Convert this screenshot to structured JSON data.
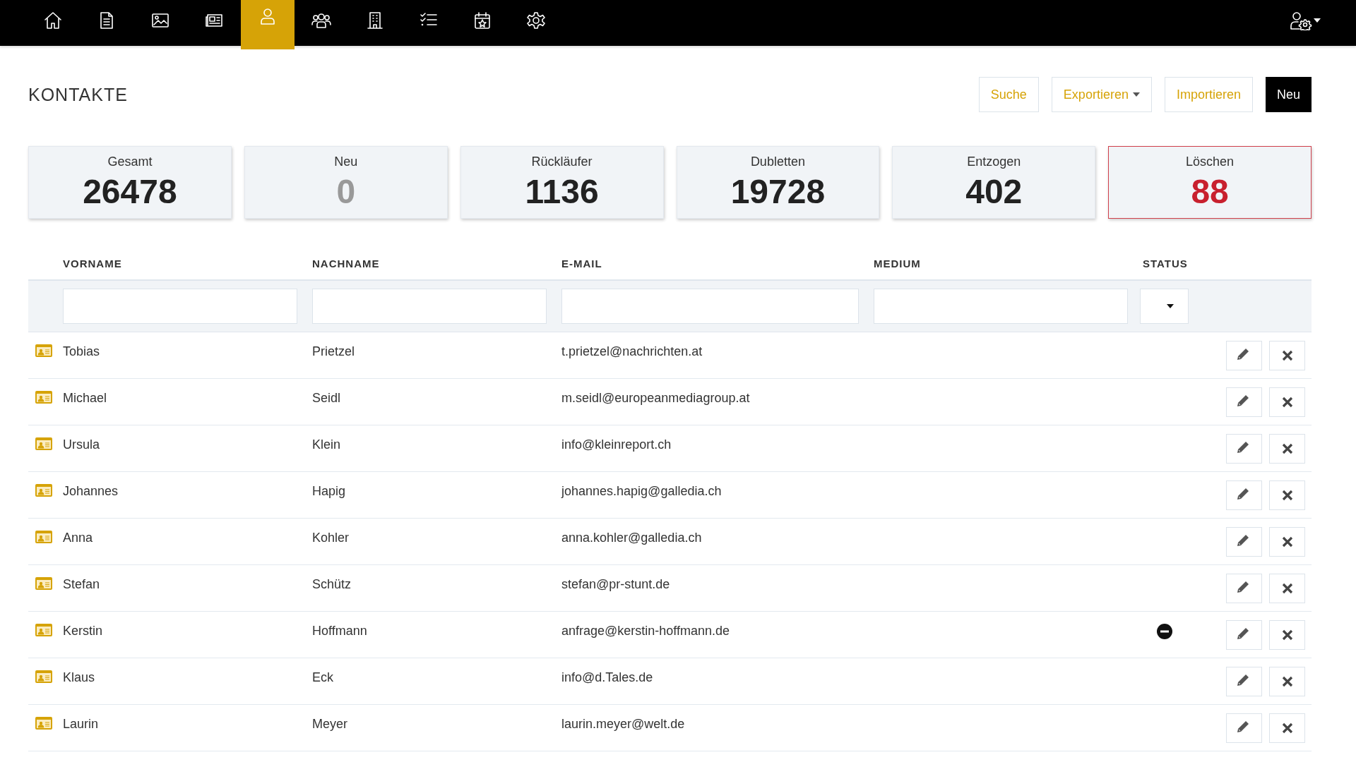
{
  "nav": {
    "items": [
      {
        "selected": false
      },
      {
        "selected": false
      },
      {
        "selected": false
      },
      {
        "selected": false
      },
      {
        "selected": true
      },
      {
        "selected": false
      },
      {
        "selected": false
      },
      {
        "selected": false
      },
      {
        "selected": false
      },
      {
        "selected": false
      }
    ]
  },
  "page": {
    "title": "KONTAKTE",
    "buttons": [
      {
        "label": "Suche",
        "kind": "outline"
      },
      {
        "label": "Exportieren",
        "kind": "dropdown"
      },
      {
        "label": "Importieren",
        "kind": "outline"
      },
      {
        "label": "Neu",
        "kind": "primary"
      }
    ]
  },
  "stats": [
    {
      "label": "Gesamt",
      "value": "26478",
      "kind": "normal"
    },
    {
      "label": "Neu",
      "value": "0",
      "kind": "muted"
    },
    {
      "label": "Rückläufer",
      "value": "1136",
      "kind": "normal"
    },
    {
      "label": "Dubletten",
      "value": "19728",
      "kind": "normal"
    },
    {
      "label": "Entzogen",
      "value": "402",
      "kind": "normal"
    },
    {
      "label": "Löschen",
      "value": "88",
      "kind": "alert"
    }
  ],
  "table": {
    "columns": [
      "VORNAME",
      "NACHNAME",
      "E-MAIL",
      "MEDIUM",
      "STATUS"
    ],
    "rows": [
      {
        "first": "Tobias",
        "last": "Prietzel",
        "email": "t.prietzel@nachrichten.at",
        "blocked": false
      },
      {
        "first": "Michael",
        "last": "Seidl",
        "email": "m.seidl@europeanmediagroup.at",
        "blocked": false
      },
      {
        "first": "Ursula",
        "last": "Klein",
        "email": "info@kleinreport.ch",
        "blocked": false
      },
      {
        "first": "Johannes",
        "last": "Hapig",
        "email": "johannes.hapig@galledia.ch",
        "blocked": false
      },
      {
        "first": "Anna",
        "last": "Kohler",
        "email": "anna.kohler@galledia.ch",
        "blocked": false
      },
      {
        "first": "Stefan",
        "last": "Schütz",
        "email": "stefan@pr-stunt.de",
        "blocked": false
      },
      {
        "first": "Kerstin",
        "last": "Hoffmann",
        "email": "anfrage@kerstin-hoffmann.de",
        "blocked": true
      },
      {
        "first": "Klaus",
        "last": "Eck",
        "email": "info@d.Tales.de",
        "blocked": false
      },
      {
        "first": "Laurin",
        "last": "Meyer",
        "email": "laurin.meyer@welt.de",
        "blocked": false
      }
    ]
  }
}
